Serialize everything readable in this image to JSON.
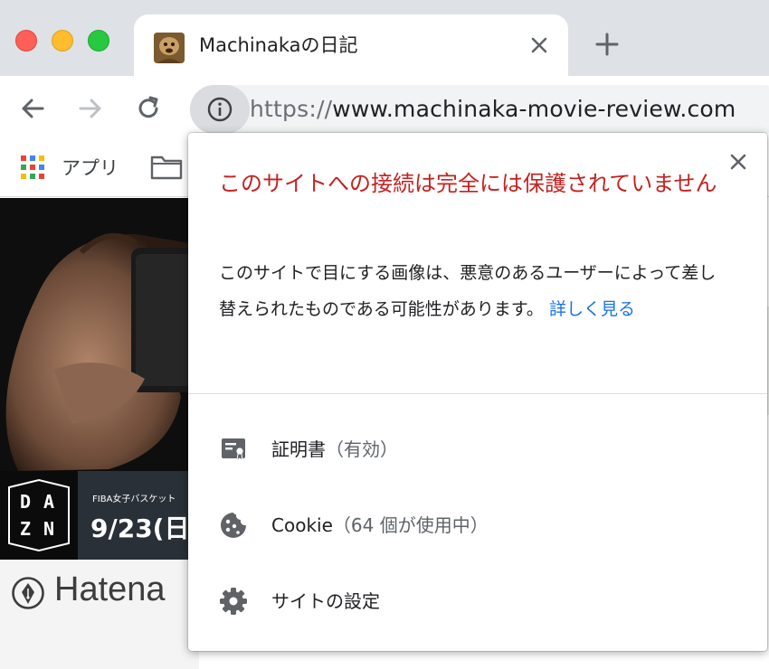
{
  "tab": {
    "title": "Machinakaの日記",
    "close_glyph": "✕",
    "new_tab_glyph": "+"
  },
  "omnibox": {
    "scheme": "https://",
    "host_path": "www.machinaka-movie-review.com"
  },
  "bookmarks": {
    "apps_label": "アプリ"
  },
  "page": {
    "banner_subtitle": "FIBA女子バスケット",
    "banner_date": "9/23(日",
    "dazn_letters": [
      "D",
      "A",
      "Z",
      "N"
    ],
    "hatena_text": "Hatena"
  },
  "popup": {
    "title": "このサイトへの接続は完全には保護されていません",
    "body": "このサイトで目にする画像は、悪意のあるユーザーによって差し替えられたものである可能性があります。",
    "learn_more": "詳しく見る",
    "close_glyph": "✕",
    "items": [
      {
        "label": "証明書",
        "sub": "（有効）",
        "icon": "certificate-icon"
      },
      {
        "label": "Cookie",
        "sub": "（64 個が使用中）",
        "icon": "cookie-icon"
      },
      {
        "label": "サイトの設定",
        "sub": "",
        "icon": "gear-icon"
      }
    ]
  },
  "colors": {
    "warning_red": "#c5221f",
    "link_blue": "#1a73e8",
    "tabstrip": "#dee1e6"
  }
}
